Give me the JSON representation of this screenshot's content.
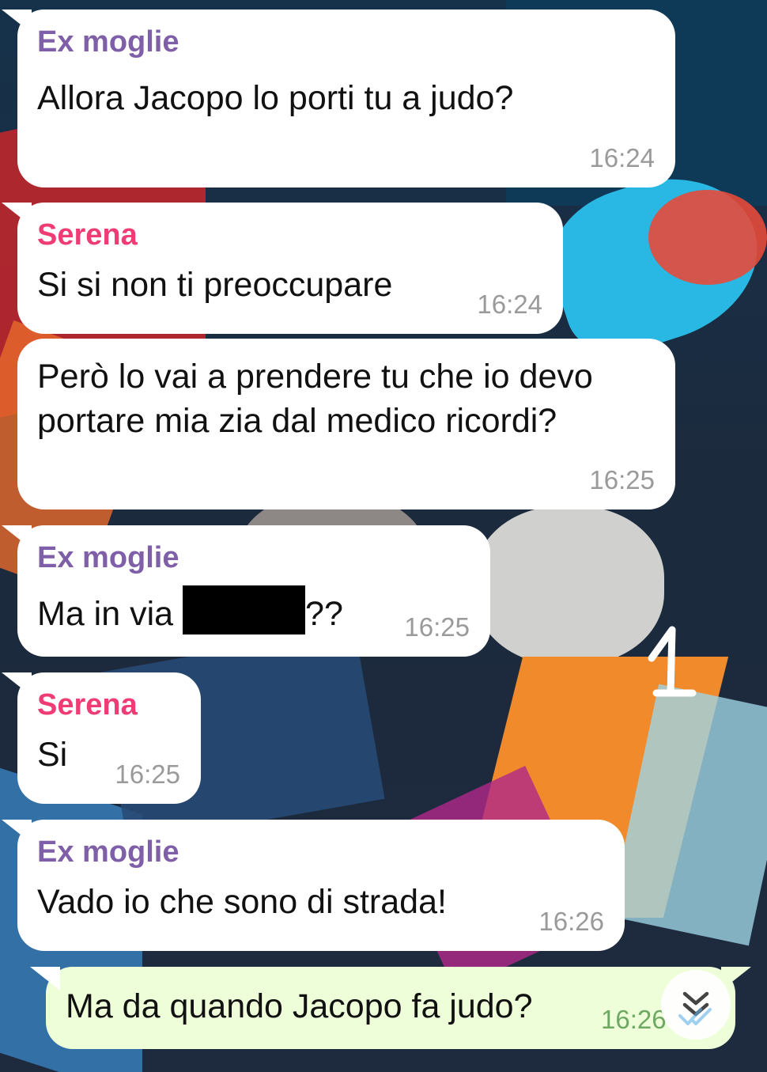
{
  "chat": {
    "messages": [
      {
        "sender": "Ex moglie",
        "text": "Allora Jacopo lo porti tu a judo?",
        "time": "16:24"
      },
      {
        "sender": "Serena",
        "text": "Si si non ti preoccupare",
        "time": "16:24"
      },
      {
        "sender": "",
        "text_line1": "Però lo vai a prendere tu che io devo",
        "text_line2": "portare mia zia dal medico ricordi?",
        "time": "16:25"
      },
      {
        "sender": "Ex moglie",
        "text_prefix": "Ma in via",
        "text_suffix": "??",
        "time": "16:25"
      },
      {
        "sender": "Serena",
        "text": "Si",
        "time": "16:25"
      },
      {
        "sender": "Ex moglie",
        "text": "Vado io che sono di strada!",
        "time": "16:26"
      }
    ],
    "outgoing": {
      "text": "Ma da quando Jacopo fa judo?",
      "time": "16:26"
    }
  },
  "annotation": {
    "label": "1"
  },
  "icons": {
    "scroll": "chevron-double-down-icon",
    "status": "double-check-icon"
  },
  "colors": {
    "sender_ex": "#7f5fa8",
    "sender_serena": "#ef3c74",
    "outgoing_bubble": "#eefed9",
    "check": "#5fb0e8"
  }
}
